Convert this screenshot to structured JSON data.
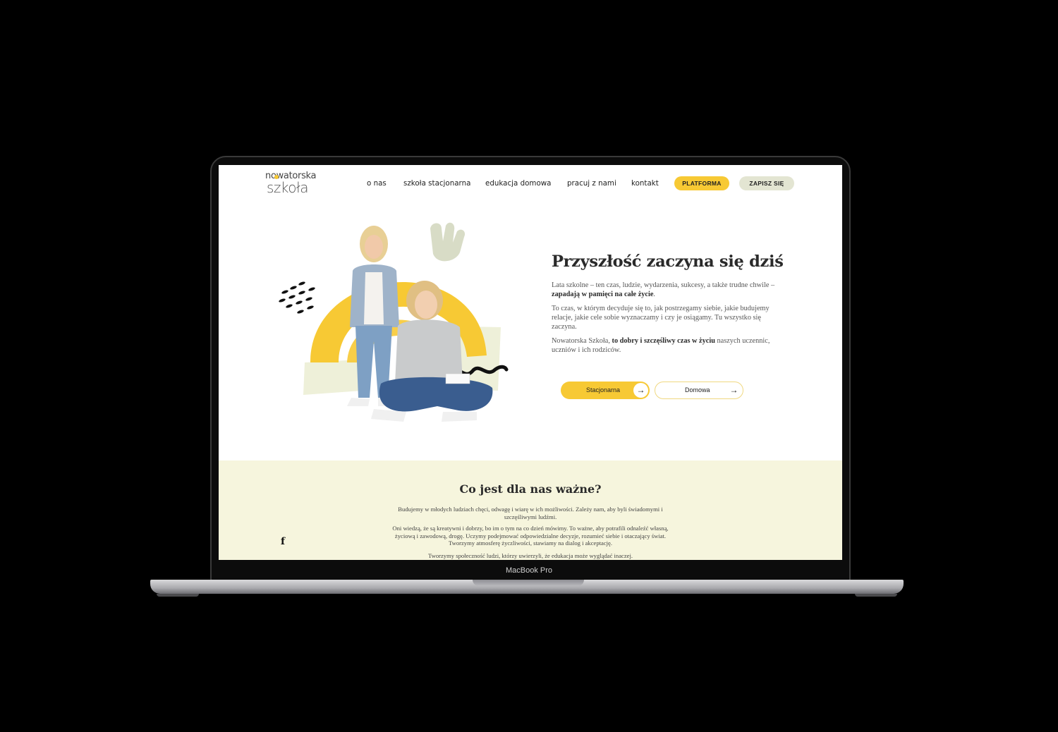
{
  "device": {
    "label": "MacBook Pro"
  },
  "logo": {
    "line1": "nowatorska",
    "line2": "szkoła"
  },
  "nav": {
    "items": [
      "o nas",
      "szkoła stacjonarna",
      "edukacja domowa",
      "pracuj z nami",
      "kontakt"
    ],
    "platform_button": "PLATFORMA",
    "signup_button": "ZAPISZ SIĘ"
  },
  "hero": {
    "title": "Przyszłość zaczyna się dziś",
    "p1_a": "Lata szkolne  – ten czas, ludzie, wydarzenia, sukcesy, a także trudne chwile – ",
    "p1_b": "zapadają w pamięci na całe życie",
    "p1_c": ".",
    "p2": "To czas, w którym decyduje się to, jak postrzegamy siebie, jakie budujemy relacje,  jakie cele sobie wyznaczamy i czy je osiągamy. Tu wszystko się zaczyna.",
    "p3_a": "Nowatorska Szkoła, ",
    "p3_b": "to dobry i szczęśliwy czas w życiu",
    "p3_c": " naszych uczennic, uczniów i ich rodziców.",
    "cta_primary": "Stacjonarna",
    "cta_secondary": "Domowa"
  },
  "values": {
    "title": "Co jest dla nas ważne?",
    "p1": "Budujemy w młodych ludziach chęci, odwagę i wiarę w ich możliwości. Zależy nam, aby byli świadomymi i szczęśliwymi ludźmi.",
    "p2": "Oni wiedzą, że są kreatywni i dobrzy, bo im o tym na co dzień mówimy. To ważne, aby potrafili odnaleźć własną, życiową i zawodową, drogę. Uczymy podejmować odpowiedzialne decyzje, rozumieć siebie i otaczający świat. Tworzymy atmosferę życzliwości, stawiamy na dialog i akceptację.",
    "p3": "Tworzymy społeczność ludzi, którzy uwierzyli, że edukacja może wyglądać inaczej."
  },
  "social": {
    "facebook": "f"
  },
  "colors": {
    "accent": "#f7c934",
    "soft": "#e3e5d2",
    "section_bg": "#f6f5dd"
  },
  "icons": [
    "arrow-right-icon",
    "facebook-icon"
  ]
}
